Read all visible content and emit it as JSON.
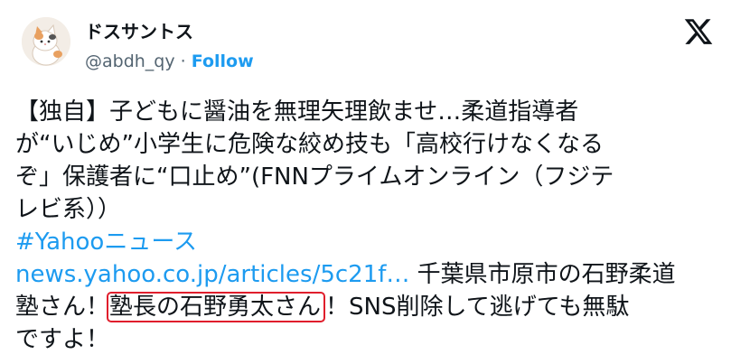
{
  "author": {
    "display_name": "ドスサントス",
    "handle": "@abdh_qy",
    "separator": "·",
    "follow_label": "Follow"
  },
  "platform_icon": "x-logo-icon",
  "tweet": {
    "line1": "【独自】子どもに醤油を無理矢理飲ませ…柔道指導者",
    "line2": "が“いじめ”小学生に危険な絞め技も「高校行けなくなる",
    "line3": "ぞ」保護者に“口止め”(FNNプライムオンライン（フジテ",
    "line4": "レビ系））",
    "hashtag": "#Yahooニュース",
    "link_text": "news.yahoo.co.jp/articles/5c21f…",
    "line6_rest": " 千葉県市原市の石野柔道",
    "line7_pre": "塾さん！",
    "line7_highlight": "塾長の石野勇太さん",
    "line7_post": "！SNS削除して逃げても無駄",
    "line8": "ですよ！"
  },
  "colors": {
    "link": "#1d9bf0",
    "text": "#0f1419",
    "secondary": "#536471",
    "highlight_border": "#e01e2c"
  }
}
